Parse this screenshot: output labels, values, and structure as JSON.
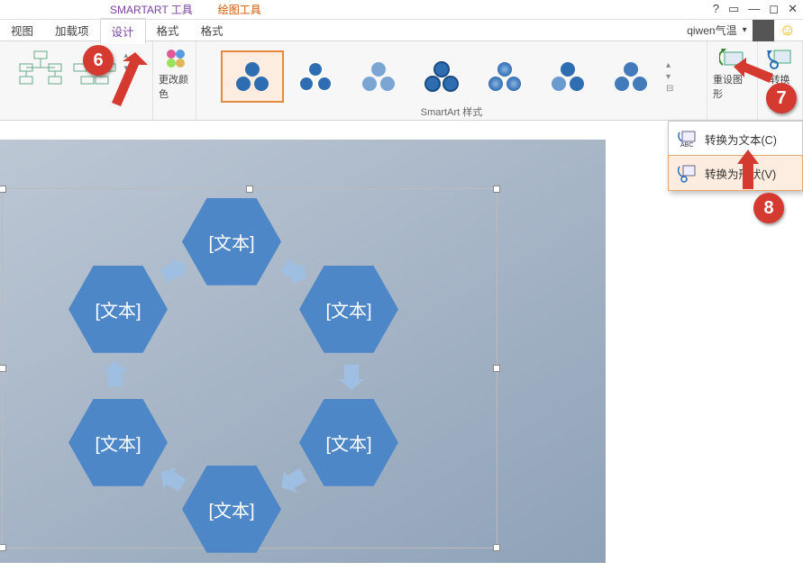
{
  "context_tabs": {
    "smartart": "SMARTART 工具",
    "drawing": "绘图工具"
  },
  "window_controls": {
    "help": "?",
    "ribbon_toggle": "▭",
    "minimize": "—",
    "restore": "◻",
    "close": "✕"
  },
  "tabs": {
    "view": "视图",
    "addins": "加载项",
    "design": "设计",
    "format1": "格式",
    "format2": "格式"
  },
  "user": {
    "name": "qiwen气温"
  },
  "ribbon": {
    "change_colors": "更改颜色",
    "styles_label": "SmartArt 样式",
    "reset": "重设图形",
    "convert": "转换"
  },
  "dropdown": {
    "to_text": "转换为文本(C)",
    "to_shapes": "转换为形状(V)"
  },
  "smartart": {
    "placeholder": "[文本]"
  },
  "callouts": {
    "n6": "6",
    "n7": "7",
    "n8": "8"
  }
}
